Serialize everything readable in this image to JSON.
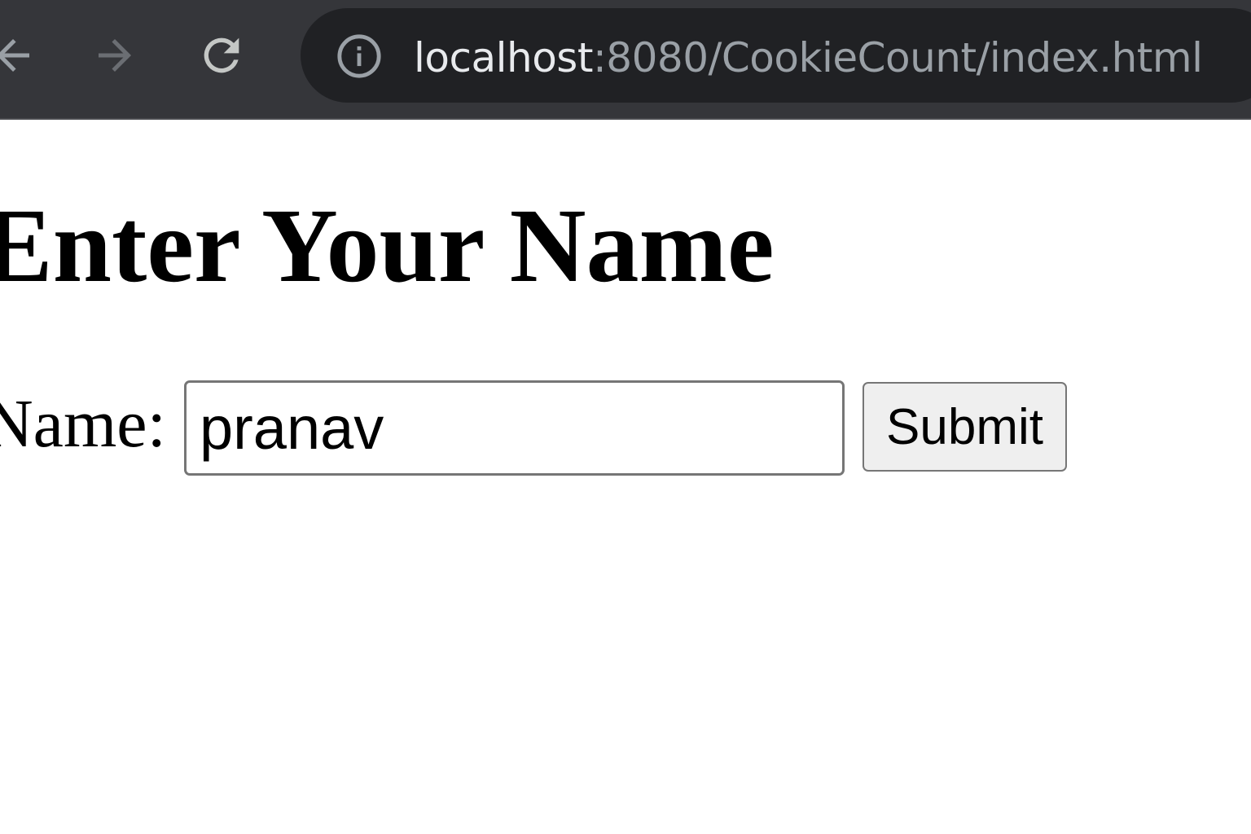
{
  "browser": {
    "url_host": "localhost",
    "url_path": ":8080/CookieCount/index.html",
    "icons": {
      "back": "arrow-left-icon",
      "forward": "arrow-right-icon",
      "reload": "reload-icon",
      "site_info": "info-icon"
    },
    "colors": {
      "toolbar_bg": "#35363a",
      "omnibox_bg": "#202124",
      "url_host": "#e8eaed",
      "url_path": "#9aa0a6"
    }
  },
  "page": {
    "heading": "Enter Your Name",
    "form": {
      "name_label": "Name:",
      "name_value": "pranav",
      "submit_label": "Submit"
    }
  }
}
